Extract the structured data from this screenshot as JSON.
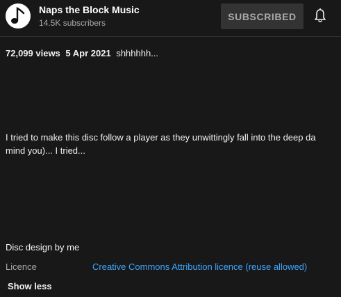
{
  "channel": {
    "name": "Naps the Block Music",
    "subscribers": "14.5K subscribers",
    "avatar_icon": "music-note-icon",
    "subscribe_label": "SUBSCRIBED",
    "bell_icon": "bell-icon"
  },
  "description": {
    "views": "72,099 views",
    "date": "5 Apr 2021",
    "tagline": "shhhhhh...",
    "paragraph_lines": [
      "I tried to make this disc follow a player as they unwittingly fall into the deep da",
      "mind you)... I tried..."
    ],
    "disc_design": "Disc design by me",
    "licence_label": "Licence",
    "licence_link": "Creative Commons Attribution licence (reuse allowed)",
    "show_less_label": "Show less"
  },
  "colors": {
    "background": "#181818",
    "text": "#f1f1f1",
    "secondary_text": "#aaaaaa",
    "link": "#3ea6ff",
    "subscribed_button_bg": "#333333"
  }
}
